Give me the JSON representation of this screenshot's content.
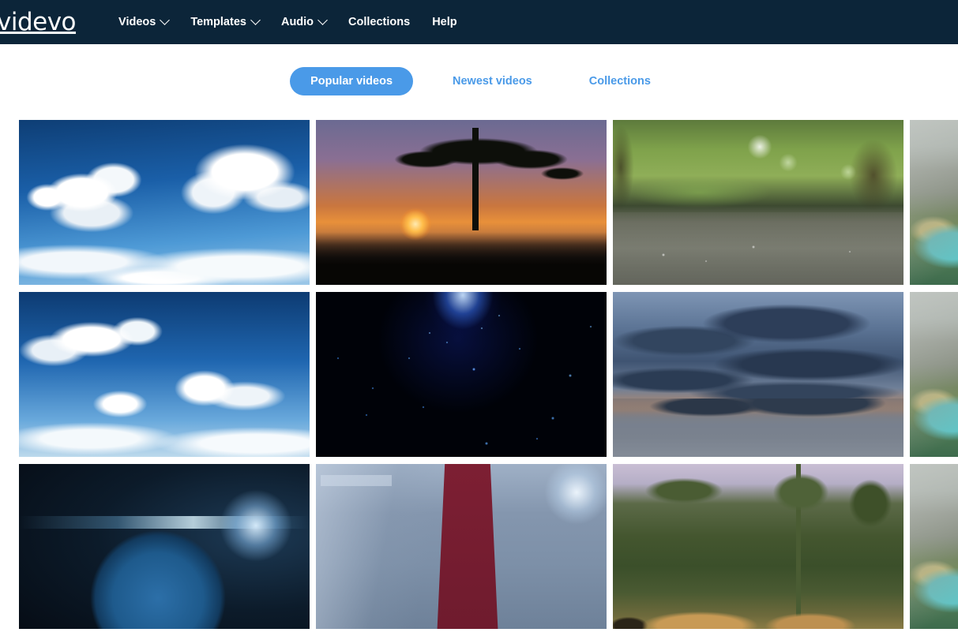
{
  "site": {
    "logo_text": "videvo",
    "brand_navy": "#0c2539",
    "brand_blue": "#4a9ae8"
  },
  "navbar": {
    "items": [
      {
        "label": "Videos",
        "has_dropdown": true,
        "icon": "chevron-down-icon"
      },
      {
        "label": "Templates",
        "has_dropdown": true,
        "icon": "chevron-down-icon"
      },
      {
        "label": "Audio",
        "has_dropdown": true,
        "icon": "chevron-down-icon"
      },
      {
        "label": "Collections",
        "has_dropdown": false,
        "icon": ""
      },
      {
        "label": "Help",
        "has_dropdown": false,
        "icon": ""
      }
    ]
  },
  "tabs": {
    "items": [
      {
        "label": "Popular videos",
        "active": true
      },
      {
        "label": "Newest videos",
        "active": false
      },
      {
        "label": "Collections",
        "active": false
      }
    ]
  },
  "gallery": {
    "rows": [
      {
        "cards": [
          {
            "name": "thumbnail-blue-sky-clouds",
            "alt": "Blue sky with white cumulus clouds"
          },
          {
            "name": "thumbnail-savanna-sunset-acacia",
            "alt": "African savanna sunset with acacia tree silhouette and flying birds"
          },
          {
            "name": "thumbnail-rain-on-ground",
            "alt": "Rain drops splashing on wet ground with blurred green foliage"
          },
          {
            "name": "thumbnail-mountain-valley-river",
            "alt": "Mountain valley with turquoise river and misty peaks"
          }
        ]
      },
      {
        "cards": [
          {
            "name": "thumbnail-blue-sky-clouds-2",
            "alt": "Deep blue sky with scattered white clouds"
          },
          {
            "name": "thumbnail-blue-particles",
            "alt": "Blue glowing particles and stars on black background"
          },
          {
            "name": "thumbnail-lake-sunset-clouds",
            "alt": "Dramatic dark clouds over a lake at sunset with mountain"
          },
          {
            "name": "thumbnail-mountain-valley-river-2",
            "alt": "Green valley with river and forest"
          }
        ]
      },
      {
        "cards": [
          {
            "name": "thumbnail-earth-from-space",
            "alt": "Planet Earth from space with bright lens flare"
          },
          {
            "name": "thumbnail-businessman",
            "alt": "Businessman in grey suit and maroon shirt"
          },
          {
            "name": "thumbnail-lions-savanna",
            "alt": "Lions walking in savanna woodland"
          },
          {
            "name": "thumbnail-valley-partial",
            "alt": "Green hillside landscape"
          }
        ]
      }
    ]
  }
}
